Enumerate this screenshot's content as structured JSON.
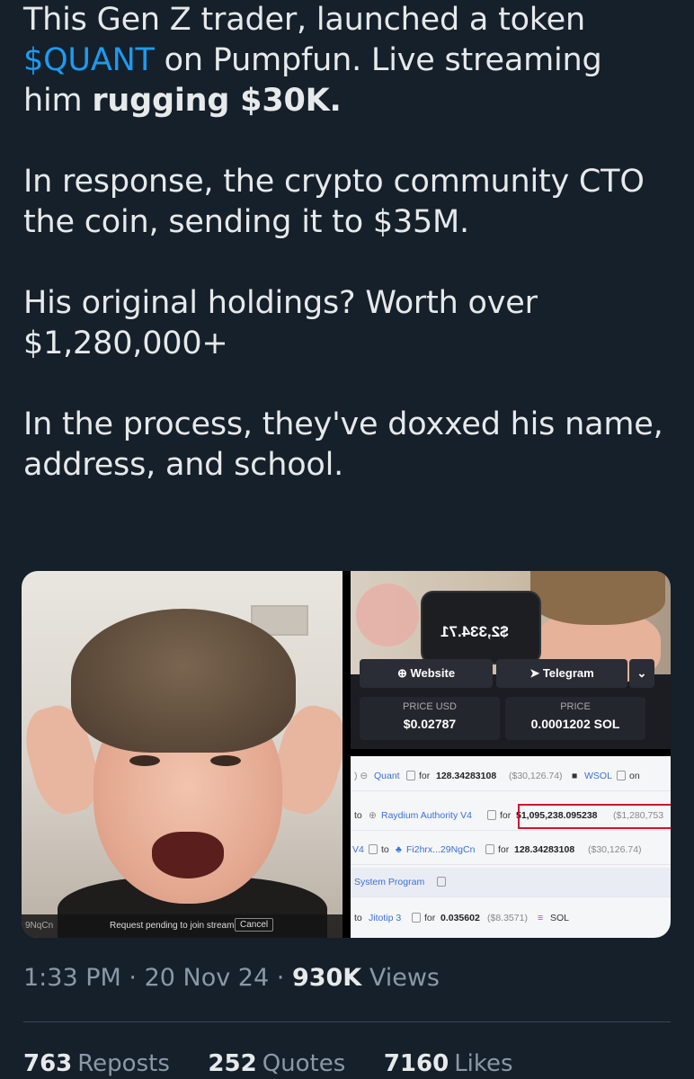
{
  "tweet": {
    "line1_pre": "This Gen Z trader, launched a token",
    "cashtag": "$QUANT",
    "line2_post": " on Pumpfun. Live streaming",
    "line3_pre": "him ",
    "line3_bold": "rugging $30K.",
    "para2": "In response, the crypto community CTO the coin, sending it to $35M.",
    "para3": "His original holdings? Worth over $1,280,000+",
    "para4": "In the process, they've doxxed his name, address, and school."
  },
  "media": {
    "stream": {
      "id_label": "9NqCn",
      "request_text": "Request pending to join stream",
      "cancel_label": "Cancel"
    },
    "token_panel": {
      "phone_value": "$2,334.71",
      "website_label": "Website",
      "telegram_label": "Telegram",
      "price_usd_label": "PRICE USD",
      "price_usd_value": "$0.02787",
      "price_label": "PRICE",
      "price_value": "0.0001202 SOL"
    },
    "transactions": {
      "row1": {
        "token": "Quant",
        "for": "for",
        "amount": "128.34283108",
        "usd": "($30,126.74)",
        "asset": "WSOL",
        "on": "on"
      },
      "row2": {
        "to": "to",
        "dest": "Raydium Authority V4",
        "for": "for",
        "amount": "51,095,238.095238",
        "usd": "($1,280,753"
      },
      "row3": {
        "src": "V4",
        "to": "to",
        "dest": "Fi2hrx...29NgCn",
        "for": "for",
        "amount": "128.34283108",
        "usd": "($30,126.74)"
      },
      "row4": {
        "program": "System Program"
      },
      "row5": {
        "to": "to",
        "dest": "Jitotip 3",
        "for": "for",
        "amount": "0.035602",
        "usd": "($8.3571)",
        "asset": "SOL"
      }
    }
  },
  "meta": {
    "time": "1:33 PM",
    "sep": "·",
    "date": "20 Nov 24",
    "views_count": "930K",
    "views_label": "Views"
  },
  "stats": {
    "reposts_count": "763",
    "reposts_label": "Reposts",
    "quotes_count": "252",
    "quotes_label": "Quotes",
    "likes_count": "7160",
    "likes_label": "Likes"
  },
  "colors": {
    "background": "#15202b",
    "text": "#e7e9ea",
    "link": "#1d9bf0",
    "muted": "#8b98a5",
    "highlight_box": "#d0142c"
  }
}
